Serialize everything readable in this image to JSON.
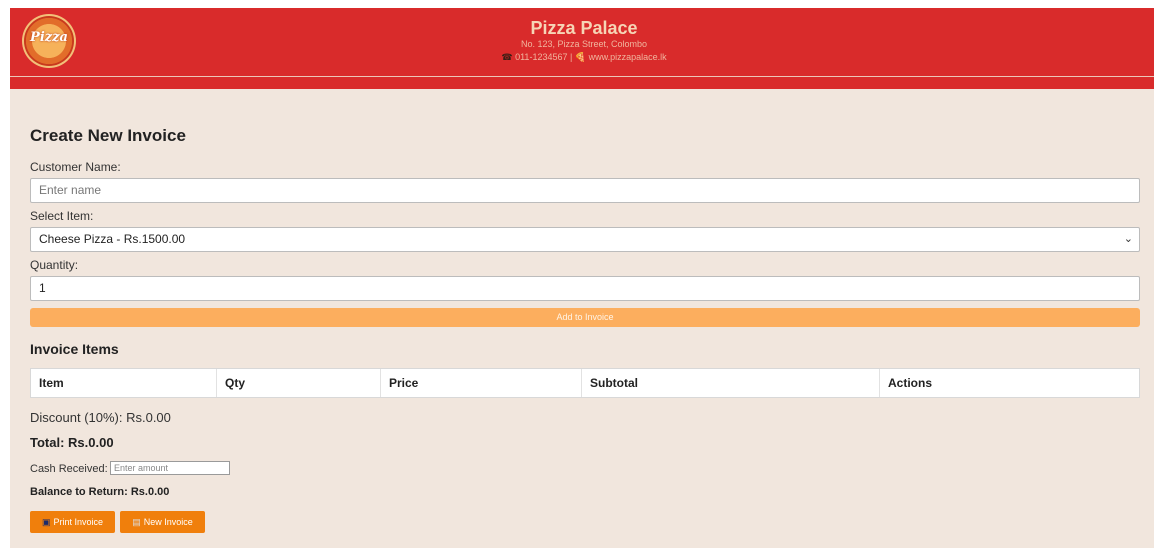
{
  "header": {
    "logo_text": "Pizza",
    "shop_name": "Pizza Palace",
    "address": "No. 123, Pizza Street, Colombo",
    "phone_icon": "☎",
    "phone": "011-1234567",
    "separator": "|",
    "web_icon": "🍕",
    "website": "www.pizzapalace.lk"
  },
  "form": {
    "title": "Create New Invoice",
    "customer_label": "Customer Name:",
    "customer_placeholder": "Enter name",
    "item_label": "Select Item:",
    "item_selected": "Cheese Pizza - Rs.1500.00",
    "quantity_label": "Quantity:",
    "quantity_value": "1",
    "add_button": "Add to Invoice"
  },
  "invoice": {
    "section_title": "Invoice Items",
    "columns": [
      "Item",
      "Qty",
      "Price",
      "Subtotal",
      "Actions"
    ],
    "discount": "Discount (10%): Rs.0.00",
    "total": "Total: Rs.0.00",
    "cash_label": "Cash Received:",
    "cash_placeholder": "Enter amount",
    "balance": "Balance to Return: Rs.0.00"
  },
  "actions": {
    "print_icon": "printer-icon",
    "print_label": "Print Invoice",
    "new_icon": "document-icon",
    "new_label": "New Invoice"
  },
  "colors": {
    "header": "#d92b2b",
    "background": "#f1e6dd",
    "add_button": "#fcae5e",
    "action_button": "#f07f0c"
  }
}
